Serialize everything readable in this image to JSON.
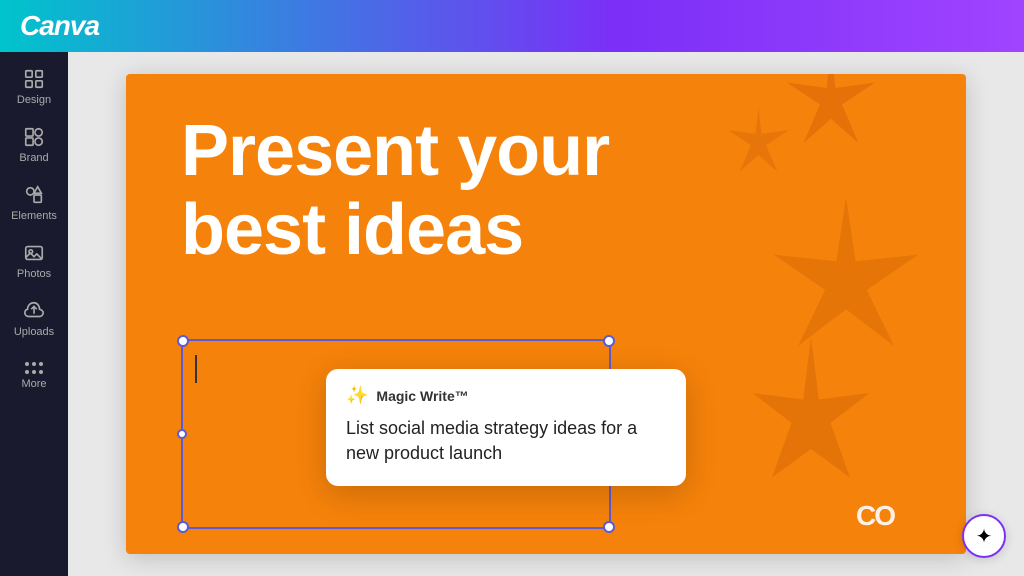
{
  "header": {
    "logo": "Canva"
  },
  "sidebar": {
    "items": [
      {
        "id": "design",
        "label": "Design",
        "icon": "grid"
      },
      {
        "id": "brand",
        "label": "Brand",
        "icon": "brand"
      },
      {
        "id": "elements",
        "label": "Elements",
        "icon": "elements"
      },
      {
        "id": "photos",
        "label": "Photos",
        "icon": "photos"
      },
      {
        "id": "uploads",
        "label": "Uploads",
        "icon": "uploads"
      }
    ],
    "more_label": "More"
  },
  "slide": {
    "title_line1": "Present your",
    "title_line2": "best ideas",
    "background_color": "#f5820a"
  },
  "magic_write": {
    "label": "Magic Write™",
    "prompt": "List social media strategy ideas for a new product launch"
  },
  "co_logo": "CO",
  "magic_button_label": "✦"
}
